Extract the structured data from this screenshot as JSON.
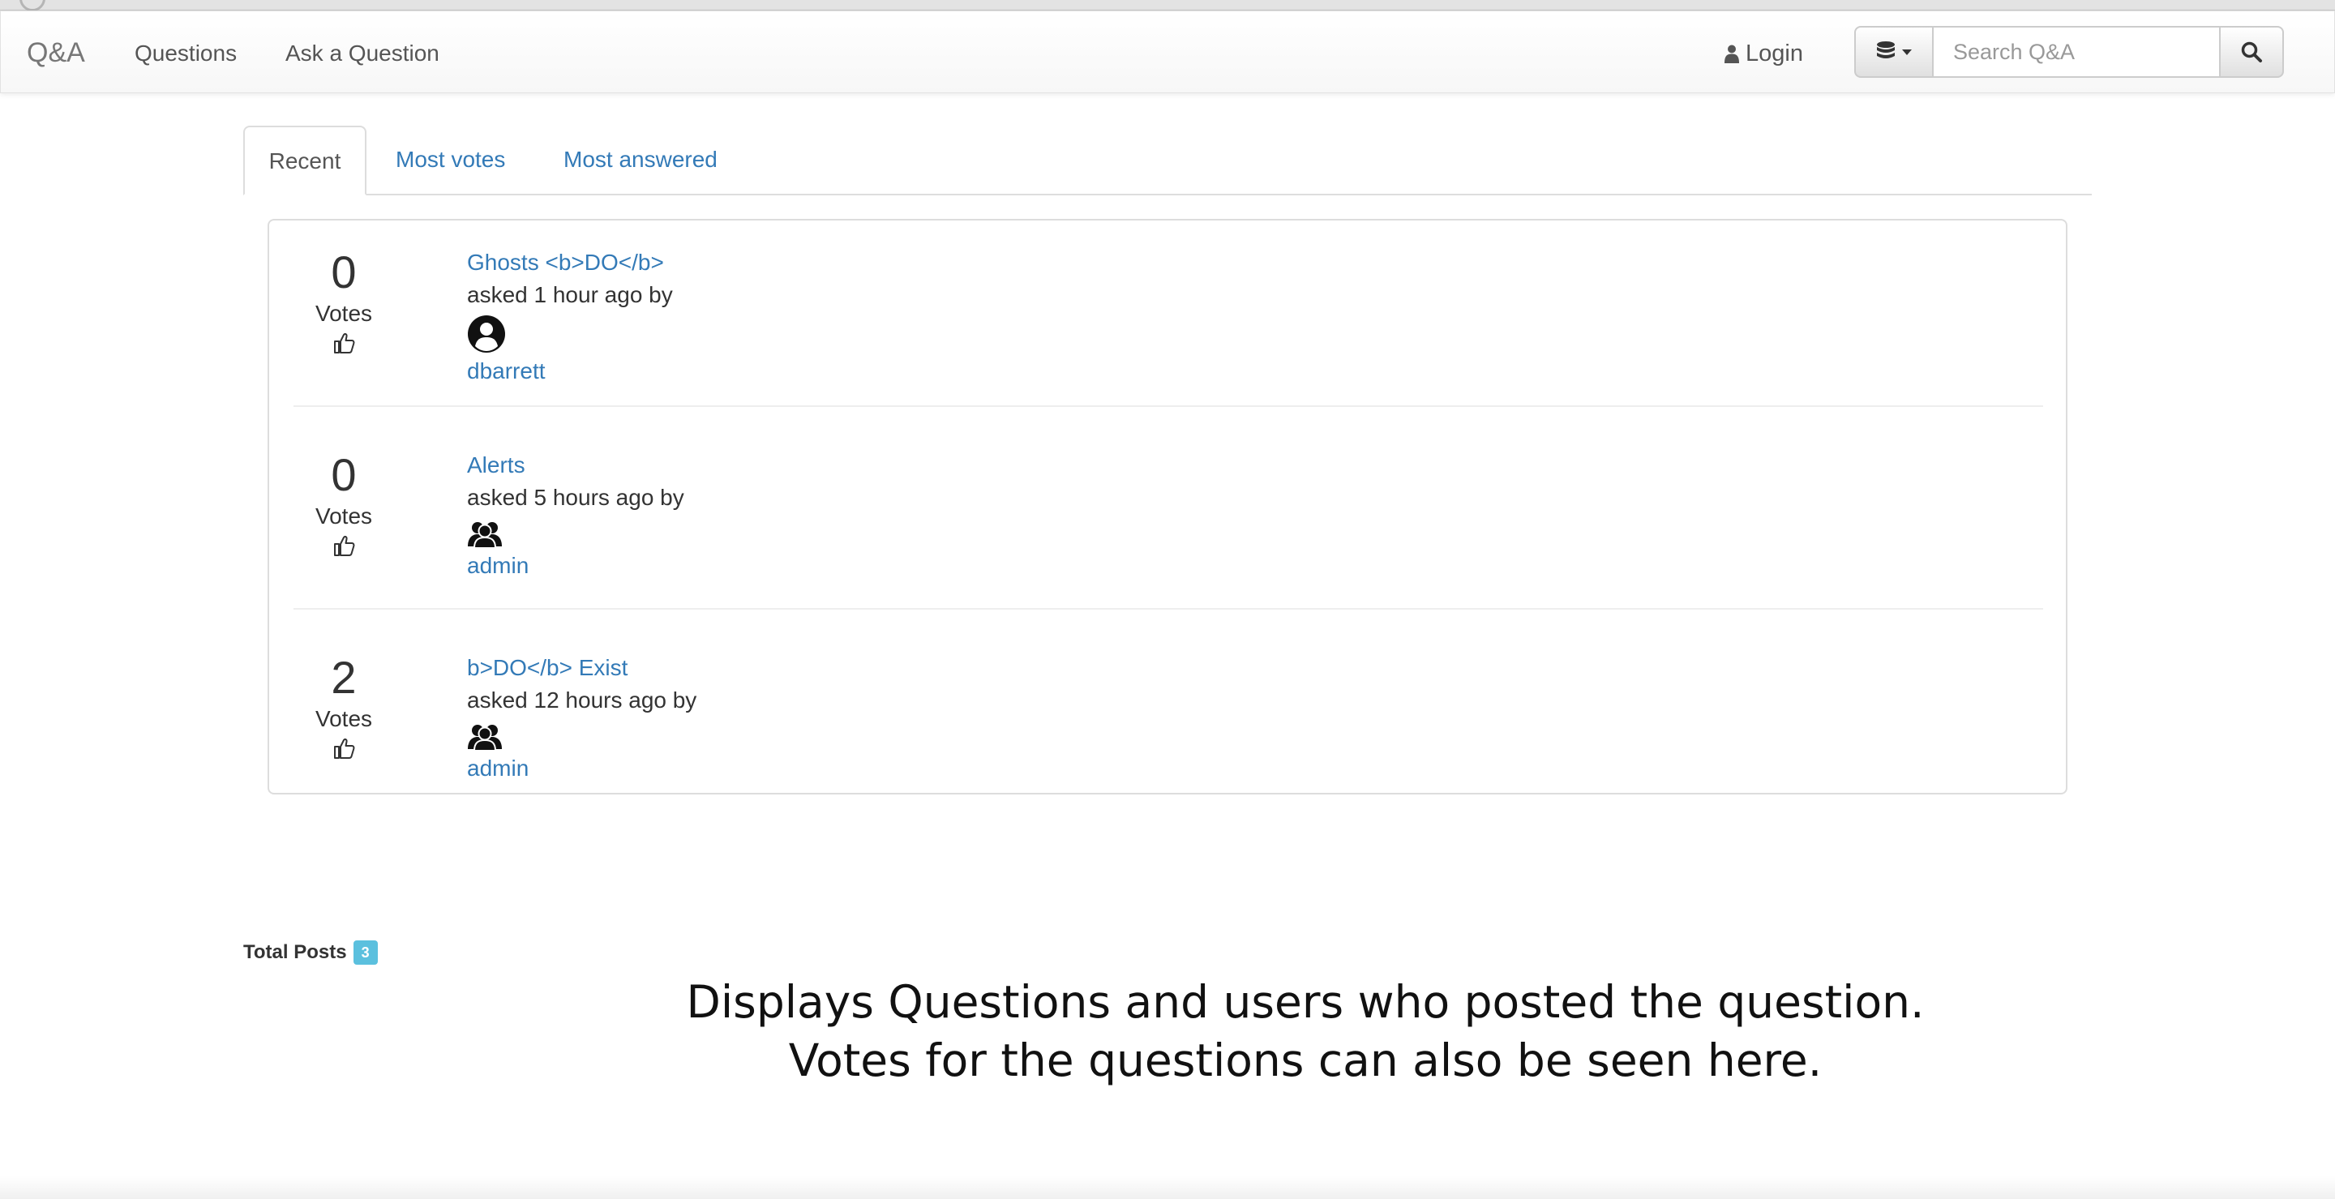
{
  "navbar": {
    "brand": "Q&A",
    "links": [
      "Questions",
      "Ask a Question"
    ],
    "login_label": "Login",
    "search": {
      "placeholder": "Search Q&A"
    }
  },
  "tabs": [
    "Recent",
    "Most votes",
    "Most answered"
  ],
  "questions": [
    {
      "votes": "0",
      "votes_label": "Votes",
      "title": "Ghosts <b>DO</b>",
      "asked": "asked 1 hour ago by",
      "user": "dbarrett",
      "avatar_icon": "user-avatar-icon"
    },
    {
      "votes": "0",
      "votes_label": "Votes",
      "title": "Alerts",
      "asked": "asked 5 hours ago by",
      "user": "admin",
      "avatar_icon": "users-group-icon"
    },
    {
      "votes": "2",
      "votes_label": "Votes",
      "title": "b>DO</b> Exist",
      "asked": "asked 12 hours ago by",
      "user": "admin",
      "avatar_icon": "users-group-icon"
    }
  ],
  "footer": {
    "total_label": "Total Posts",
    "total_count": "3"
  },
  "caption": {
    "line1": "Displays Questions and users who posted the question.",
    "line2": "Votes for the questions can also be seen here."
  },
  "colors": {
    "link": "#337ab7",
    "badge": "#5bc0de",
    "text": "#333333"
  }
}
